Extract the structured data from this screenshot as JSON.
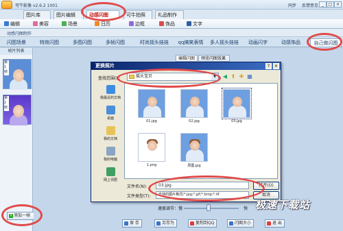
{
  "app": {
    "title": "可牛影像 v2.6.2 1001",
    "right_links": [
      "同步",
      "反馈意见"
    ]
  },
  "main_tabs": [
    "图片库",
    "图片编辑",
    "动感闪图",
    "可牛拍照",
    "礼品制作"
  ],
  "toolbar": [
    "编辑",
    "美容",
    "场景",
    "日历",
    "边框",
    "饰品",
    "文字"
  ],
  "subtitle": "动感闪图制作",
  "category_tabs": [
    "闪图场景",
    "特效闪图",
    "多图闪图",
    "多帧闪图",
    "时尚摇头娃娃",
    "qq搞笑表情",
    "多人摇头娃娃",
    "动画闪字",
    "动感饰品",
    "自己做闪图"
  ],
  "left_panel": {
    "title": "帧片列表",
    "frame_label": "第1帧",
    "frame2_label": "第2帧",
    "add_button": "添加一帧"
  },
  "sub_tabs": [
    "编辑闪图",
    "预览闪图效果"
  ],
  "dialog": {
    "title": "更换照片",
    "help": "?",
    "close": "×",
    "lookin_label": "查找范围(I):",
    "lookin_value": "摇头宝贝",
    "places": [
      "我最近的文档",
      "桌面",
      "我的文档",
      "我的电脑",
      "网上邻居"
    ],
    "files": [
      {
        "name": "01.jpg",
        "bg": "blue"
      },
      {
        "name": "02.jpg",
        "bg": "blue"
      },
      {
        "name": "03.jpg",
        "bg": "blue",
        "selected": true
      },
      {
        "name": "1.png",
        "bg": "white"
      },
      {
        "name": "原图.jpg",
        "bg": "blue"
      }
    ],
    "filename_label": "文件名(N):",
    "filename_value": "03.jpg",
    "filetype_label": "文件类型(T):",
    "filetype_value": "支持的图片格式(*.jpg;*.gif;*.bmp;*.tif",
    "open_button": "打开(O)",
    "cancel_button": "取消"
  },
  "speed": {
    "label": "速度调节：慢",
    "fast": "快",
    "level": 0.45
  },
  "bottom_buttons": [
    "保 存",
    "另存为",
    "复制到QQ",
    "闪图大小",
    "退 出"
  ],
  "watermark": "极速下载站",
  "colors": {
    "highlight": "#e04a4a",
    "accent": "#c21818"
  }
}
